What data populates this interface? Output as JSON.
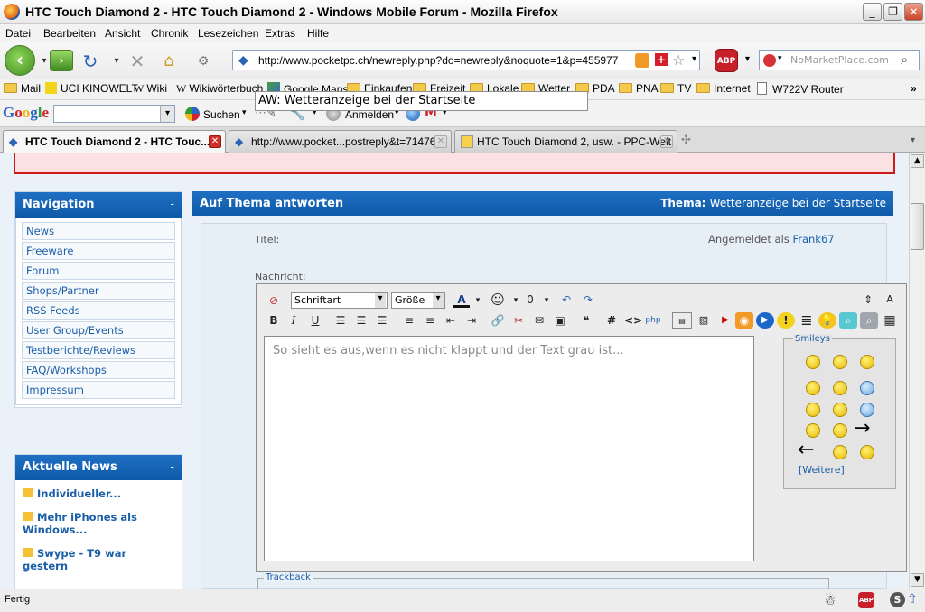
{
  "window": {
    "title": "HTC Touch Diamond 2 - HTC Touch Diamond 2 - Windows Mobile Forum - Mozilla Firefox"
  },
  "menu": [
    "Datei",
    "Bearbeiten",
    "Ansicht",
    "Chronik",
    "Lesezeichen",
    "Extras",
    "Hilfe"
  ],
  "urlbar": {
    "url": "http://www.pocketpc.ch/newreply.php?do=newreply&noquote=1&p=455977"
  },
  "searchbar": {
    "placeholder": "NoMarketPlace.com"
  },
  "bookmarks": [
    "Mail",
    "UCI KINOWELT",
    "Wiki",
    "Wikiwörterbuch",
    "Google Maps",
    "Einkaufen",
    "Freizeit",
    "Lokale",
    "Wetter",
    "PDA",
    "PNA",
    "TV",
    "Internet",
    "W722V Router"
  ],
  "googlebar": {
    "logo": "Google",
    "search_label": "Suchen",
    "login_label": "Anmelden"
  },
  "tabs": [
    {
      "label": "HTC Touch Diamond 2 - HTC Touc..."
    },
    {
      "label": "http://www.pocket...postreply&t=71476"
    },
    {
      "label": "HTC Touch Diamond 2, usw. - PPC-Welt"
    }
  ],
  "sidebar": {
    "nav_title": "Navigation",
    "minimize": "-",
    "nav_items": [
      "News",
      "Freeware",
      "Forum",
      "Shops/Partner",
      "RSS Feeds",
      "User Group/Events",
      "Testberichte/Reviews",
      "FAQ/Workshops",
      "Impressum"
    ],
    "news_title": "Aktuelle News",
    "news_items": [
      "Individueller...",
      "Mehr iPhones als Windows...",
      "Swype - T9 war gestern"
    ]
  },
  "main": {
    "header": "Auf Thema antworten",
    "thema_label": "Thema:",
    "thema_value": "Wetteranzeige bei der Startseite",
    "title_label": "Titel:",
    "title_value": "AW: Wetteranzeige bei der Startseite",
    "logged_in_label": "Angemeldet als",
    "logged_in_user": "Frank67",
    "message_label": "Nachricht:",
    "font_select": "Schriftart",
    "size_select": "Größe",
    "message_text": "So sieht es aus,wenn es nicht klappt und der Text grau ist...",
    "smileys_title": "Smileys",
    "more_smileys": "[Weitere]",
    "trackback": "Trackback"
  },
  "status": {
    "text": "Fertig"
  }
}
